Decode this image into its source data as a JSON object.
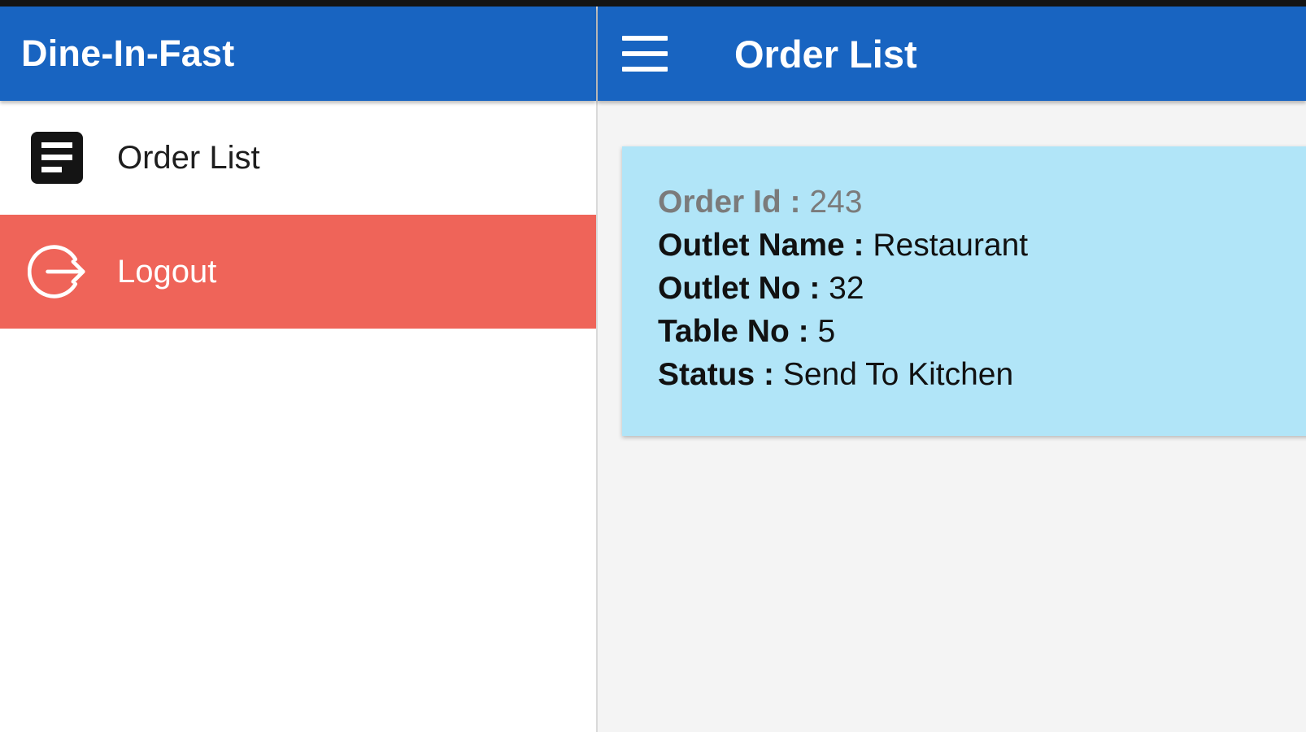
{
  "app": {
    "title": "Dine-In-Fast"
  },
  "sidebar": {
    "items": [
      {
        "label": "Order List",
        "icon": "document-list-icon"
      },
      {
        "label": "Logout",
        "icon": "logout-icon"
      }
    ]
  },
  "appbar": {
    "title": "Order List",
    "menu_icon": "hamburger-menu-icon"
  },
  "orders": [
    {
      "order_id_label": "Order Id : ",
      "order_id": "243",
      "outlet_name_label": "Outlet Name : ",
      "outlet_name": "Restaurant",
      "outlet_no_label": "Outlet No : ",
      "outlet_no": "32",
      "table_no_label": "Table No : ",
      "table_no": "5",
      "status_label": "Status : ",
      "status": "Send To Kitchen"
    }
  ],
  "colors": {
    "primary": "#1864c1",
    "logout_bg": "#ef6459",
    "card_bg": "#b1e5f8",
    "content_bg": "#f4f4f4"
  }
}
